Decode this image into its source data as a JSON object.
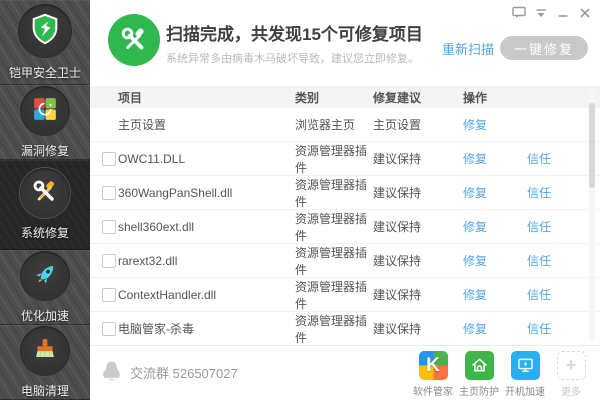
{
  "app": {
    "name": "铠甲安全卫士",
    "colors": {
      "accent_green": "#2fb750",
      "link_blue": "#55a5e6",
      "button_gray": "#c9c9c9"
    }
  },
  "sidebar": {
    "items": [
      {
        "label": "漏洞修复",
        "icon": "windows-update-icon",
        "active": false
      },
      {
        "label": "系统修复",
        "icon": "tools-icon",
        "active": true
      },
      {
        "label": "优化加速",
        "icon": "rocket-icon",
        "active": false
      },
      {
        "label": "电脑清理",
        "icon": "brush-icon",
        "active": false
      }
    ]
  },
  "header": {
    "title": "扫描完成，共发现15个可修复项目",
    "subtitle": "系统异常多由病毒木马破坏导致，建议您立即修复。",
    "rescan_label": "重新扫描",
    "fix_all_label": "一键修复",
    "found_count": "15"
  },
  "table": {
    "columns": [
      "项目",
      "类别",
      "修复建议",
      "操作"
    ],
    "rows": [
      {
        "name": "主页设置",
        "category": "浏览器主页",
        "suggestion": "主页设置",
        "fix": "修复",
        "trust": ""
      },
      {
        "name": "OWC11.DLL",
        "category": "资源管理器插件",
        "suggestion": "建议保持",
        "fix": "修复",
        "trust": "信任"
      },
      {
        "name": "360WangPanShell.dll",
        "category": "资源管理器插件",
        "suggestion": "建议保持",
        "fix": "修复",
        "trust": "信任"
      },
      {
        "name": "shell360ext.dll",
        "category": "资源管理器插件",
        "suggestion": "建议保持",
        "fix": "修复",
        "trust": "信任"
      },
      {
        "name": "rarext32.dll",
        "category": "资源管理器插件",
        "suggestion": "建议保持",
        "fix": "修复",
        "trust": "信任"
      },
      {
        "name": "ContextHandler.dll",
        "category": "资源管理器插件",
        "suggestion": "建议保持",
        "fix": "修复",
        "trust": "信任"
      },
      {
        "name": "电脑管家-杀毒",
        "category": "资源管理器插件",
        "suggestion": "建议保持",
        "fix": "修复",
        "trust": "信任"
      }
    ]
  },
  "footer": {
    "group_label": "交流群",
    "group_number": "526507027",
    "shortcuts": [
      {
        "label": "软件管家",
        "icon": "k-app-icon",
        "glyph": "K"
      },
      {
        "label": "主页防护",
        "icon": "home-shield-icon"
      },
      {
        "label": "开机加速",
        "icon": "boot-speed-icon"
      },
      {
        "label": "更多",
        "icon": "more-plus-icon",
        "glyph": "+"
      }
    ]
  }
}
